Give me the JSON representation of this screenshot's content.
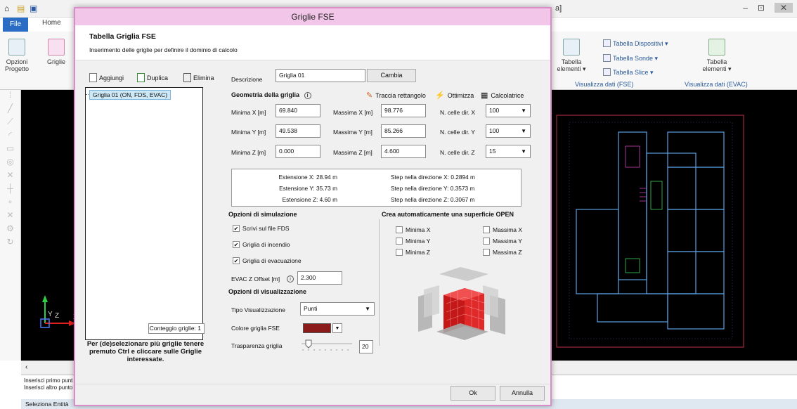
{
  "app": {
    "title_fragment": "a]",
    "file_tab": "File",
    "home_tab": "Home",
    "window_controls": [
      "–",
      "⊡",
      "✕"
    ]
  },
  "ribbon": {
    "opzioni_progetto": "Opzioni\nProgetto",
    "griglie": "Griglie",
    "tabella_elementi_fse": "Tabella\nelementi ▾",
    "tabella_dispositivi": "Tabella Dispositivi ▾",
    "tabella_sonde": "Tabella Sonde ▾",
    "tabella_slice": "Tabella Slice ▾",
    "group_fse": "Visualizza dati (FSE)",
    "tabella_elementi_evac": "Tabella\nelementi ▾",
    "group_evac": "Visualizza dati (EVAC)"
  },
  "cmdline": {
    "line1": "Inserisci primo punt",
    "line2": "Inserisci altro punto",
    "status": "Seleziona Entità"
  },
  "dialog": {
    "title": "Griglie FSE",
    "close": "✕",
    "header_title": "Tabella Griglia FSE",
    "header_sub": "Inserimento delle griglie per definire il dominio di calcolo",
    "toolbar": {
      "add": "Aggiungi",
      "duplicate": "Duplica",
      "delete": "Elimina"
    },
    "tree_item": "Griglia 01 (ON, FDS, EVAC)",
    "count": "Conteggio griglie: 1",
    "hint": "Per (de)selezionare più griglie tenere premuto Ctrl e cliccare sulle Griglie interessate.",
    "descrizione_label": "Descrizione",
    "descrizione_value": "Griglia 01",
    "cambia": "Cambia",
    "geometry_title": "Geometria della griglia",
    "traccia": "Traccia rettangolo",
    "ottimizza": "Ottimizza",
    "calcolatrice": "Calcolatrice",
    "min_x_label": "Minima X [m]",
    "min_x": "69.840",
    "max_x_label": "Massima X [m]",
    "max_x": "98.776",
    "cells_x_label": "N. celle dir. X",
    "cells_x": "100",
    "min_y_label": "Minima Y [m]",
    "min_y": "49.538",
    "max_y_label": "Massima Y [m]",
    "max_y": "85.266",
    "cells_y_label": "N. celle dir. Y",
    "cells_y": "100",
    "min_z_label": "Minima Z [m]",
    "min_z": "0.000",
    "max_z_label": "Massima Z [m]",
    "max_z": "4.600",
    "cells_z_label": "N. celle dir. Z",
    "cells_z": "15",
    "ext_x": "Estensione X: 28.94 m",
    "ext_y": "Estensione Y: 35.73 m",
    "ext_z": "Estensione Z: 4.60 m",
    "step_x": "Step nella direzione X: 0.2894 m",
    "step_y": "Step nella direzione Y: 0.3573 m",
    "step_z": "Step nella direzione Z: 0.3067 m",
    "sim_title": "Opzioni di simulazione",
    "scrivi_fds": "Scrivi sul file FDS",
    "griglia_incendio": "Griglia di incendio",
    "griglia_evac": "Griglia di evacuazione",
    "evac_offset_label": "EVAC Z Offset [m]",
    "evac_offset": "2.300",
    "vis_title": "Opzioni di visualizzazione",
    "tipo_vis_label": "Tipo Visualizzazione",
    "tipo_vis": "Punti",
    "colore_label": "Colore griglia FSE",
    "colore": "#8b1a1a",
    "trasparenza_label": "Trasparenza griglia",
    "trasparenza": "20",
    "open_title": "Crea automaticamente una superficie OPEN",
    "open": {
      "min_x": "Minima X",
      "min_y": "Minima Y",
      "min_z": "Minima Z",
      "max_x": "Massima X",
      "max_y": "Massima Y",
      "max_z": "Massima Z"
    },
    "ok": "Ok",
    "annulla": "Annulla"
  }
}
